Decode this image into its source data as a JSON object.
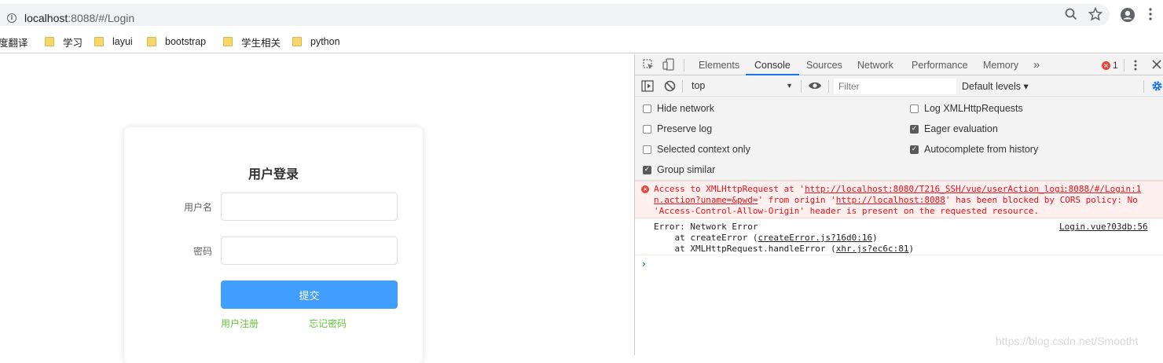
{
  "browser": {
    "url_host": "localhost",
    "url_rest": ":8088/#/Login",
    "bookmarks": [
      {
        "label": "度翻译",
        "has_folder": false
      },
      {
        "label": "学习",
        "has_folder": true
      },
      {
        "label": "layui",
        "has_folder": true
      },
      {
        "label": "bootstrap",
        "has_folder": true
      },
      {
        "label": "学生相关",
        "has_folder": true
      },
      {
        "label": "python",
        "has_folder": true
      }
    ]
  },
  "login": {
    "title": "用户登录",
    "username_label": "用户名",
    "username_value": "",
    "password_label": "密码",
    "password_value": "",
    "submit_label": "提交",
    "register_link": "用户注册",
    "forgot_link": "忘记密码"
  },
  "devtools": {
    "tabs": [
      "Elements",
      "Console",
      "Sources",
      "Network",
      "Performance",
      "Memory"
    ],
    "active_tab": "Console",
    "more_tabs": "»",
    "error_count": "1",
    "context": "top",
    "filter_placeholder": "Filter",
    "levels": "Default levels ▾",
    "settings_left": [
      {
        "label": "Hide network",
        "checked": false
      },
      {
        "label": "Preserve log",
        "checked": false
      },
      {
        "label": "Selected context only",
        "checked": false
      },
      {
        "label": "Group similar",
        "checked": true
      }
    ],
    "settings_right": [
      {
        "label": "Log XMLHttpRequests",
        "checked": false
      },
      {
        "label": "Eager evaluation",
        "checked": true
      },
      {
        "label": "Autocomplete from history",
        "checked": true
      }
    ],
    "error_message": {
      "line1_pre": "Access to XMLHttpRequest at '",
      "line1_link": "http://localhost:8080/T216_SSH/vue/userAction_logi",
      "line2_link": "n.action?uname=&pwd=",
      "line2_mid": "' from origin '",
      "line2_origin": "http://localhost:8088",
      "line2_post": "' has been blocked by CORS policy: No",
      "line3": "'Access-Control-Allow-Origin' header is present on the requested resource.",
      "source": ":8088/#/Login:1"
    },
    "log_message": {
      "line1": "Error: Network Error",
      "line2_pre": "    at createError (",
      "line2_link": "createError.js?16d0:16",
      "line2_post": ")",
      "line3_pre": "    at XMLHttpRequest.handleError (",
      "line3_link": "xhr.js?ec6c:81",
      "line3_post": ")",
      "source": "Login.vue?03db:56"
    },
    "prompt": "›"
  },
  "watermark": "https://blog.csdn.net/Smootht",
  "colors": {
    "primary_button": "#409eff",
    "link_green": "#67c23a",
    "error_red": "#e8131c",
    "error_bg": "#fff0f0",
    "devtools_accent": "#1a73e8"
  }
}
